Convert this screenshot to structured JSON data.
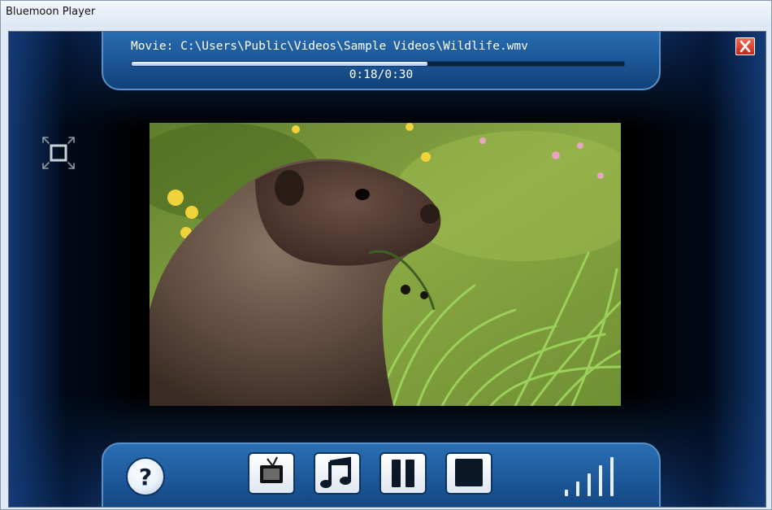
{
  "window": {
    "title": "Bluemoon Player"
  },
  "media": {
    "movie_text": "Movie: C:\\Users\\Public\\Videos\\Sample Videos\\Wildlife.wmv",
    "time_text": "0:18/0:30",
    "progress_fraction": 0.6
  },
  "controls": {
    "help_symbol": "?",
    "buttons": [
      {
        "name": "tv-icon"
      },
      {
        "name": "music-note-icon"
      },
      {
        "name": "pause-icon"
      },
      {
        "name": "stop-icon"
      }
    ],
    "volume_level": 5,
    "volume_max": 5
  },
  "colors": {
    "panel_blue": "#1b5596",
    "close_red": "#d8341f",
    "window_chrome": "#dfe8f3"
  },
  "icons": {
    "close": "close-icon",
    "fullscreen": "fullscreen-icon",
    "help": "help-icon",
    "volume": "volume-bars-icon"
  }
}
